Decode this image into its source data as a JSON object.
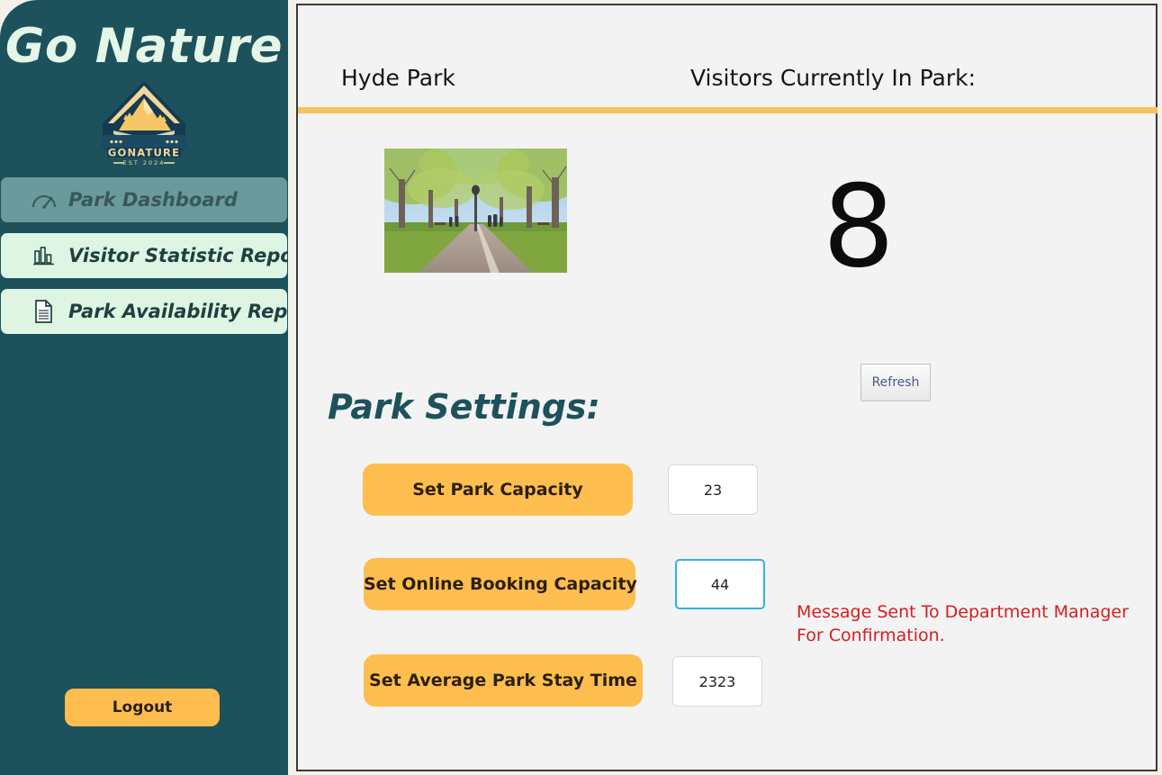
{
  "sidebar": {
    "brand_title": "Go Nature",
    "logo": {
      "wordmark": "GONATURE",
      "established": "EST 2024",
      "icon_name": "mountain-emblem-logo"
    },
    "items": [
      {
        "label": "Park Dashboard",
        "icon": "gauge-icon",
        "active": true
      },
      {
        "label": "Visitor Statistic Report",
        "icon": "bar-chart-icon",
        "active": false
      },
      {
        "label": "Park Availability Report",
        "icon": "document-icon",
        "active": false
      }
    ],
    "logout_label": "Logout"
  },
  "header": {
    "park_name": "Hyde Park",
    "visitors_label": "Visitors Currently In Park:"
  },
  "main": {
    "park_photo_alt": "park-pathway-photo",
    "visitor_count": "8",
    "refresh_label": "Refresh",
    "settings_title": "Park Settings:",
    "settings": [
      {
        "label": "Set Park Capacity",
        "value": "23",
        "focused": false
      },
      {
        "label": "Set Online Booking Capacity",
        "value": "44",
        "focused": true
      },
      {
        "label": "Set Average Park Stay Time",
        "value": "2323",
        "focused": false
      }
    ],
    "confirmation_message": "Message Sent To Department Manager For Confirmation."
  },
  "colors": {
    "sidebar_bg": "#1d525c",
    "nav_active_bg": "#6b9a9c",
    "nav_plain_bg": "#dff5e3",
    "accent_orange": "#fdbe4f",
    "divider_orange": "#f6c35c",
    "message_red": "#d32020",
    "panel_bg": "#f3f3f3",
    "page_bg": "#f4f0ea"
  }
}
